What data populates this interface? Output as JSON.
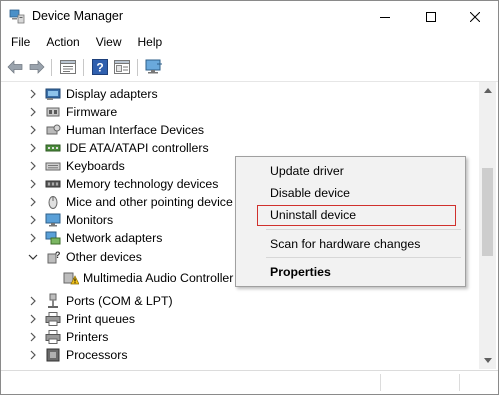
{
  "window": {
    "title": "Device Manager"
  },
  "menu": {
    "items": [
      "File",
      "Action",
      "View",
      "Help"
    ]
  },
  "toolbar": {
    "buttons": [
      "back-icon",
      "forward-icon",
      "properties-icon",
      "help-icon",
      "view-icon",
      "monitor-scan-icon"
    ]
  },
  "tree": {
    "items": [
      {
        "label": "Display adapters",
        "expanded": false,
        "icon": "display-adapter-icon"
      },
      {
        "label": "Firmware",
        "expanded": false,
        "icon": "firmware-icon"
      },
      {
        "label": "Human Interface Devices",
        "expanded": false,
        "icon": "hid-icon"
      },
      {
        "label": "IDE ATA/ATAPI controllers",
        "expanded": false,
        "icon": "ide-controller-icon"
      },
      {
        "label": "Keyboards",
        "expanded": false,
        "icon": "keyboard-icon"
      },
      {
        "label": "Memory technology devices",
        "expanded": false,
        "icon": "memory-icon"
      },
      {
        "label": "Mice and other pointing device",
        "expanded": false,
        "icon": "mouse-icon"
      },
      {
        "label": "Monitors",
        "expanded": false,
        "icon": "monitor-icon"
      },
      {
        "label": "Network adapters",
        "expanded": false,
        "icon": "network-adapter-icon"
      },
      {
        "label": "Other devices",
        "expanded": true,
        "icon": "unknown-device-icon"
      },
      {
        "label": "Multimedia Audio Controller",
        "child": true,
        "icon": "warning-device-icon"
      },
      {
        "label": "Ports (COM & LPT)",
        "expanded": false,
        "icon": "port-icon"
      },
      {
        "label": "Print queues",
        "expanded": false,
        "icon": "printer-icon"
      },
      {
        "label": "Printers",
        "expanded": false,
        "icon": "printer-icon"
      },
      {
        "label": "Processors",
        "expanded": false,
        "icon": "processor-icon"
      }
    ]
  },
  "context_menu": {
    "items": [
      {
        "label": "Update driver"
      },
      {
        "label": "Disable device"
      },
      {
        "label": "Uninstall device",
        "highlighted": true
      },
      {
        "label": "Scan for hardware changes"
      },
      {
        "label": "Properties",
        "bold": true
      }
    ]
  },
  "colors": {
    "highlight_border": "#d0312d",
    "menu_bg": "#f2f2f2"
  }
}
